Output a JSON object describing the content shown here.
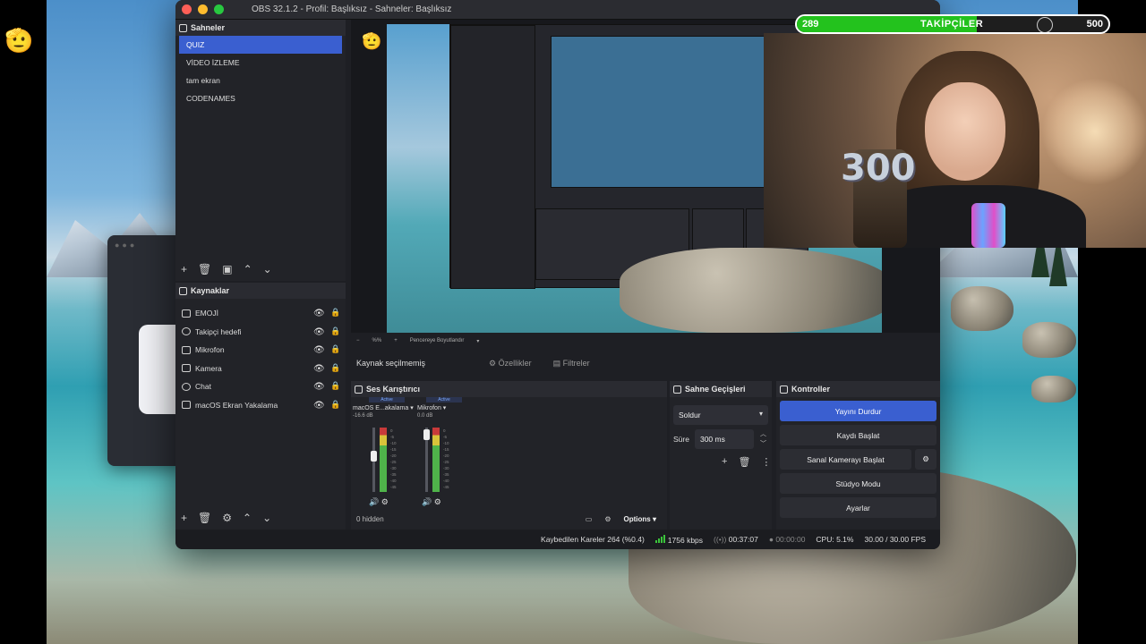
{
  "window": {
    "title": "OBS 32.1.2 - Profil: Başlıksız - Sahneler: Başlıksız"
  },
  "scenes": {
    "header": "Sahneler",
    "items": [
      "QUIZ",
      "VİDEO İZLEME",
      "tam ekran",
      "CODENAMES"
    ]
  },
  "sources": {
    "header": "Kaynaklar",
    "items": [
      "EMOJİ",
      "Takipçi hedefi",
      "Mikrofon",
      "Kamera",
      "Chat",
      "macOS Ekran Yakalama"
    ]
  },
  "preview_bar": {
    "no_source": "Kaynak seçilmemiş",
    "properties": "Özellikler",
    "filters": "Filtreler",
    "zoom": "%%",
    "fit": "Pencereye Boyutlandır"
  },
  "mixer": {
    "header": "Ses Karıştırıcı",
    "channels": [
      {
        "active": "Active",
        "name": "macOS E...akalama",
        "db": "-16.6 dB"
      },
      {
        "active": "Active",
        "name": "Mikrofon",
        "db": "0.0 dB"
      }
    ],
    "scale": [
      "0",
      "-5",
      "-10",
      "-15",
      "-20",
      "-25",
      "-30",
      "-35",
      "-40",
      "-45",
      "-50",
      "-55",
      "-60"
    ],
    "hidden": "0 hidden",
    "options": "Options"
  },
  "transitions": {
    "header": "Sahne Geçişleri",
    "selected": "Soldur",
    "duration_label": "Süre",
    "duration_value": "300 ms"
  },
  "controls": {
    "header": "Kontroller",
    "stop_stream": "Yayını Durdur",
    "start_recording": "Kaydı Başlat",
    "start_virtual_cam": "Sanal Kamerayı Başlat",
    "studio_mode": "Stüdyo Modu",
    "settings": "Ayarlar"
  },
  "status": {
    "dropped_frames": "Kaybedilen Kareler 264 (%0.4)",
    "bitrate": "1756 kbps",
    "stream_time": "00:37:07",
    "record_time": "00:00:00",
    "cpu": "CPU: 5.1%",
    "fps": "30.00 / 30.00 FPS"
  },
  "goal": {
    "current": "289",
    "label": "TAKİPÇİLER",
    "target": "500",
    "progress": 0.578
  },
  "cake_text": "300",
  "colors": {
    "accent": "#3a5fd0",
    "goal_fill": "#23c21d"
  }
}
